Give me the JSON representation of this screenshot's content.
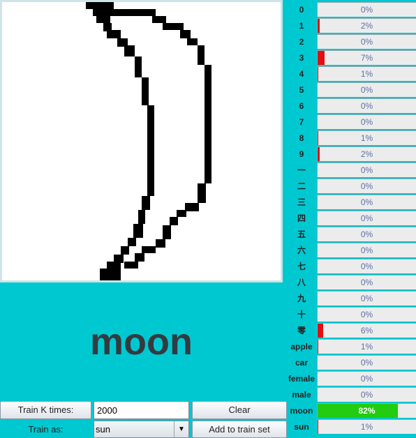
{
  "prediction": "moon",
  "classes": [
    {
      "label": "0",
      "percent": 0,
      "text": "0%"
    },
    {
      "label": "1",
      "percent": 2,
      "text": "2%"
    },
    {
      "label": "2",
      "percent": 0,
      "text": "0%"
    },
    {
      "label": "3",
      "percent": 7,
      "text": "7%"
    },
    {
      "label": "4",
      "percent": 1,
      "text": "1%"
    },
    {
      "label": "5",
      "percent": 0,
      "text": "0%"
    },
    {
      "label": "6",
      "percent": 0,
      "text": "0%"
    },
    {
      "label": "7",
      "percent": 0,
      "text": "0%"
    },
    {
      "label": "8",
      "percent": 1,
      "text": "1%"
    },
    {
      "label": "9",
      "percent": 2,
      "text": "2%"
    },
    {
      "label": "一",
      "percent": 0,
      "text": "0%"
    },
    {
      "label": "二",
      "percent": 0,
      "text": "0%"
    },
    {
      "label": "三",
      "percent": 0,
      "text": "0%"
    },
    {
      "label": "四",
      "percent": 0,
      "text": "0%"
    },
    {
      "label": "五",
      "percent": 0,
      "text": "0%"
    },
    {
      "label": "六",
      "percent": 0,
      "text": "0%"
    },
    {
      "label": "七",
      "percent": 0,
      "text": "0%"
    },
    {
      "label": "八",
      "percent": 0,
      "text": "0%"
    },
    {
      "label": "九",
      "percent": 0,
      "text": "0%"
    },
    {
      "label": "十",
      "percent": 0,
      "text": "0%"
    },
    {
      "label": "零",
      "percent": 6,
      "text": "6%"
    },
    {
      "label": "apple",
      "percent": 1,
      "text": "1%"
    },
    {
      "label": "car",
      "percent": 0,
      "text": "0%"
    },
    {
      "label": "female",
      "percent": 0,
      "text": "0%"
    },
    {
      "label": "male",
      "percent": 0,
      "text": "0%"
    },
    {
      "label": "moon",
      "percent": 82,
      "text": "82%"
    },
    {
      "label": "sun",
      "percent": 1,
      "text": "1%"
    }
  ],
  "colors": {
    "low_bar": "#e01010",
    "top_bar": "#22cc10",
    "background": "#00c8d0"
  },
  "controls": {
    "train_k_label": "Train K times:",
    "train_k_value": "2000",
    "clear_label": "Clear",
    "train_as_label": "Train as:",
    "train_as_value": "sun",
    "add_label": "Add to train set"
  }
}
